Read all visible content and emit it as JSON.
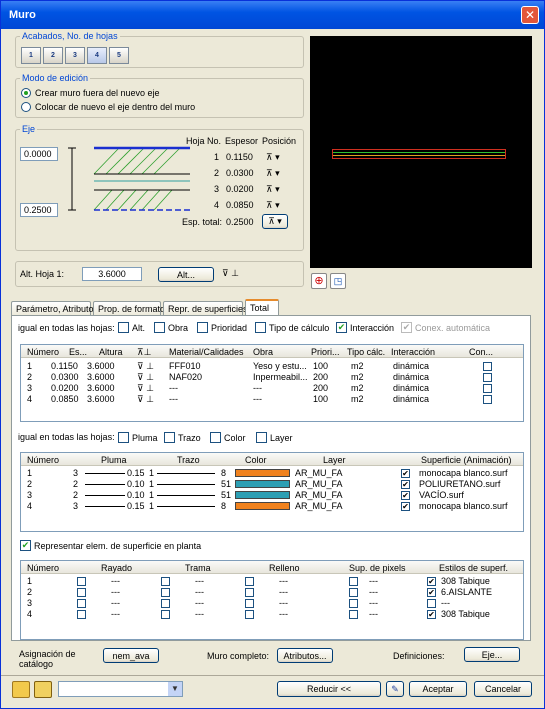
{
  "window": {
    "title": "Muro",
    "close": "✕"
  },
  "acabados": {
    "title": "Acabados, No. de hojas",
    "buttons": [
      "1",
      "2",
      "3",
      "4",
      "5"
    ]
  },
  "modo": {
    "title": "Modo de edición",
    "opt1": "Crear muro fuera del nuevo eje",
    "opt2": "Colocar de nuevo el eje dentro del muro"
  },
  "eje": {
    "title": "Eje",
    "top_value": "0.0000",
    "bottom_value": "0.2500",
    "col_hoja": "Hoja No.",
    "col_espesor": "Espesor",
    "col_posicion": "Posición",
    "rows": [
      {
        "n": "1",
        "v": "0.1150"
      },
      {
        "n": "2",
        "v": "0.0300"
      },
      {
        "n": "3",
        "v": "0.0200"
      },
      {
        "n": "4",
        "v": "0.0850"
      }
    ],
    "total_label": "Esp. total:",
    "total_value": "0.2500"
  },
  "alt": {
    "label": "Alt. Hoja 1:",
    "value": "3.6000",
    "button": "Alt..."
  },
  "tabs": [
    "Parámetro, Atributo",
    "Prop. de formato",
    "Repr. de superficies",
    "Total"
  ],
  "igual1": {
    "label": "igual en todas las hojas:",
    "items": [
      {
        "l": "Alt.",
        "c": false
      },
      {
        "l": "Obra",
        "c": false
      },
      {
        "l": "Prioridad",
        "c": false
      },
      {
        "l": "Tipo de cálculo",
        "c": false
      },
      {
        "l": "Interacción",
        "c": true
      },
      {
        "l": "Conex. automática",
        "c": true,
        "disabled": true
      }
    ]
  },
  "table1": {
    "headers": [
      "Número",
      "Es...",
      "Altura",
      "",
      "Material/Calidades",
      "Obra",
      "Priori...",
      "Tipo cálc.",
      "Interacción",
      "Con..."
    ],
    "rows": [
      [
        "1",
        "0.1150",
        "3.6000",
        "FFF010",
        "Yeso y estu...",
        "100",
        "m2",
        "dinámica"
      ],
      [
        "2",
        "0.0300",
        "3.6000",
        "NAF020",
        "Inpermeabil...",
        "200",
        "m2",
        "dinámica"
      ],
      [
        "3",
        "0.0200",
        "3.6000",
        "---",
        "---",
        "200",
        "m2",
        "dinámica"
      ],
      [
        "4",
        "0.0850",
        "3.6000",
        "---",
        "---",
        "100",
        "m2",
        "dinámica"
      ]
    ]
  },
  "igual2": {
    "label": "igual en todas las hojas:",
    "items": [
      "Pluma",
      "Trazo",
      "Color",
      "Layer"
    ]
  },
  "table2": {
    "headers": [
      "Número",
      "Pluma",
      "Trazo",
      "Color",
      "Layer",
      "Superficie (Animación)"
    ],
    "rows": [
      [
        "1",
        "3",
        "0.15",
        "1",
        "8",
        "AR_MU_FA",
        "monocapa blanco.surf"
      ],
      [
        "2",
        "2",
        "0.10",
        "1",
        "51",
        "AR_MU_FA",
        "POLIURETANO.surf"
      ],
      [
        "3",
        "2",
        "0.10",
        "1",
        "51",
        "AR_MU_FA",
        "VACÍO.surf"
      ],
      [
        "4",
        "3",
        "0.15",
        "1",
        "8",
        "AR_MU_FA",
        "monocapa blanco.surf"
      ]
    ],
    "colors": [
      "#f0821e",
      "#2d9fb4",
      "#2d9fb4",
      "#f0821e"
    ]
  },
  "represent": {
    "label": "Representar elem. de superficie en planta"
  },
  "table3": {
    "headers": [
      "Número",
      "Rayado",
      "Trama",
      "Relleno",
      "Sup. de pixels",
      "Estilos de superf."
    ],
    "rows": [
      [
        "1",
        "---",
        "---",
        "---",
        "---",
        "308 Tabique"
      ],
      [
        "2",
        "---",
        "---",
        "---",
        "---",
        "6.AISLANTE"
      ],
      [
        "3",
        "---",
        "---",
        "---",
        "---",
        "---"
      ],
      [
        "4",
        "---",
        "---",
        "---",
        "---",
        "308 Tabique"
      ]
    ],
    "style_checked": [
      true,
      true,
      false,
      true
    ]
  },
  "bottom": {
    "asign": "Asignación de catálogo",
    "asign_btn": "nem_ava",
    "muro": "Muro completo:",
    "muro_btn": "Atributos...",
    "def": "Definiciones:",
    "def_btn": "Eje..."
  },
  "footer": {
    "reducir": "Reducir <<",
    "aceptar": "Aceptar",
    "cancelar": "Cancelar"
  }
}
